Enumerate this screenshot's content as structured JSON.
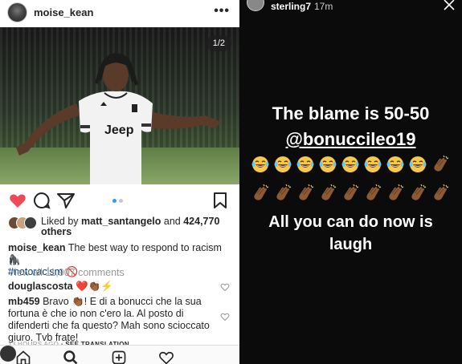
{
  "post": {
    "username": "moise_kean",
    "more": "•••",
    "photo_counter": "1/2",
    "liked_prefix": "Liked by",
    "liked_user": "matt_santangelo",
    "liked_and": "and",
    "liked_count": "424,770 others",
    "caption_user": "moise_kean",
    "caption_text": "The best way to respond to racism 🦍",
    "caption_hashtag": "#notoracism",
    "caption_emoji": "🚫",
    "view_all": "View all 11,907 comments",
    "comments": [
      {
        "user": "douglascosta",
        "text": "❤️👏🏾⚡"
      },
      {
        "user": "mb459",
        "text": "Bravo 👏🏾! E di a bonucci che la sua fortuna è che io non c'ero la. Al posto di difenderti che fa questo? Mah sono scioccato giuro. Tvb frate!"
      }
    ],
    "timestamp": "13 HOURS AGO",
    "see_translation": "SEE TRANSLATION"
  },
  "story": {
    "username": "sterling7",
    "time": "17m",
    "line1": "The blame is 50-50",
    "mention": "@bonuccileo19",
    "line2a": "All you can do now is",
    "line2b": "laugh",
    "emoji_row1": [
      "laugh",
      "laugh",
      "laugh",
      "laugh",
      "laugh",
      "laugh",
      "laugh",
      "laugh",
      "clap"
    ],
    "emoji_row2": [
      "clap",
      "clap",
      "clap",
      "clap",
      "clap",
      "clap",
      "clap",
      "clap",
      "clap"
    ]
  },
  "colors": {
    "heart_red": "#ed4956",
    "link_blue": "#003569",
    "story_bg": "#0b0b0b"
  }
}
